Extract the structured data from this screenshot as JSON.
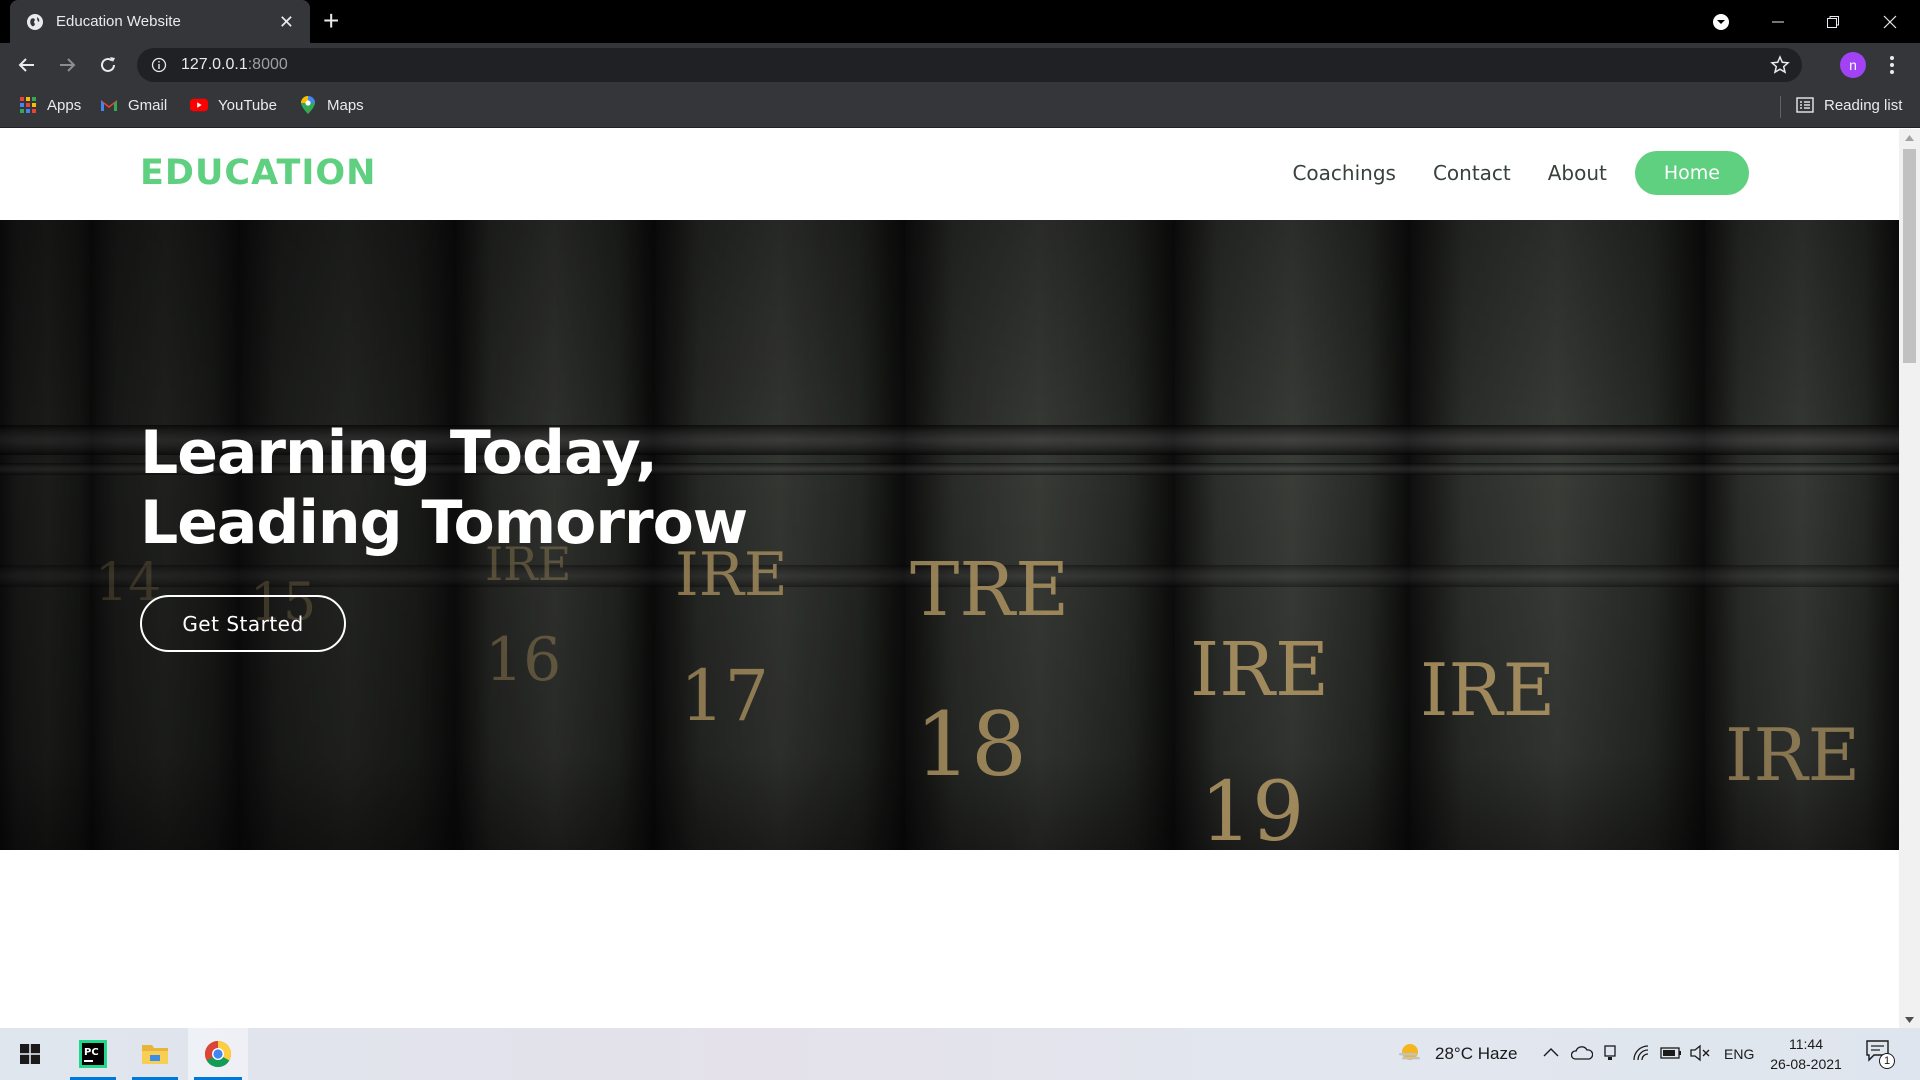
{
  "browser": {
    "tab_title": "Education Website",
    "url_host": "127.0.0.1",
    "url_port": ":8000",
    "profile_initial": "n",
    "bookmarks": [
      {
        "label": "Apps",
        "icon": "apps-grid-icon"
      },
      {
        "label": "Gmail",
        "icon": "gmail-icon"
      },
      {
        "label": "YouTube",
        "icon": "youtube-icon"
      },
      {
        "label": "Maps",
        "icon": "maps-pin-icon"
      }
    ],
    "reading_list": "Reading list"
  },
  "site": {
    "logo": "EDUCATION",
    "nav": [
      {
        "label": "Coachings"
      },
      {
        "label": "Contact"
      },
      {
        "label": "About"
      },
      {
        "label": "Home",
        "active": true
      }
    ],
    "hero": {
      "title_line1": "Learning Today,",
      "title_line2": "Leading Tomorrow",
      "cta": "Get Started"
    },
    "accent_color": "#5fcf80"
  },
  "taskbar": {
    "apps": [
      "windows-start-icon",
      "pycharm-icon",
      "file-explorer-icon",
      "chrome-icon"
    ],
    "weather": "28°C  Haze",
    "language": "ENG",
    "time": "11:44",
    "date": "26-08-2021",
    "notification_count": "1"
  }
}
